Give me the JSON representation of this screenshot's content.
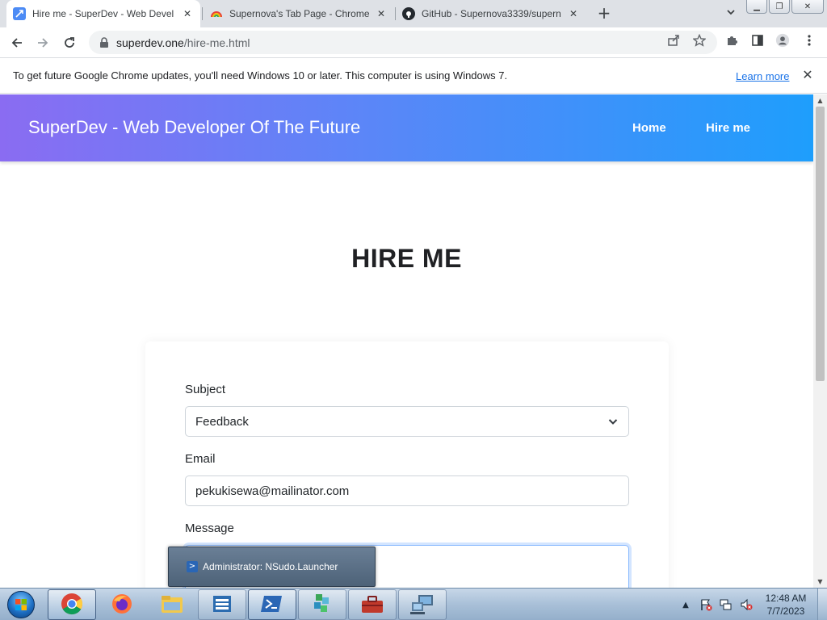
{
  "browser": {
    "tabs": [
      {
        "title": "Hire me - SuperDev - Web Devel",
        "icon": "superdev-favicon",
        "active": true
      },
      {
        "title": "Supernova's Tab Page - Chrome",
        "icon": "rainbow-favicon",
        "active": false
      },
      {
        "title": "GitHub - Supernova3339/supern",
        "icon": "github-favicon",
        "active": false
      }
    ],
    "new_tab_label": "+",
    "url_host": "superdev.one",
    "url_path": "/hire-me.html",
    "infobar": {
      "message": "To get future Google Chrome updates, you'll need Windows 10 or later. This computer is using Windows 7.",
      "learn_more": "Learn more"
    }
  },
  "site": {
    "brand": "SuperDev - Web Developer Of The Future",
    "nav": [
      "Home",
      "Hire me"
    ],
    "heading": "HIRE ME",
    "gradient": [
      "#8a6cf2",
      "#1e9efc"
    ],
    "form": {
      "subject_label": "Subject",
      "subject_value": "Feedback",
      "email_label": "Email",
      "email_value": "pekukisewa@mailinator.com",
      "message_label": "Message",
      "message_value": ""
    }
  },
  "taskbar": {
    "preview_title": "Administrator: NSudo.Launcher",
    "apps": [
      "chrome-icon",
      "firefox-icon",
      "explorer-icon",
      "control-panel-icon",
      "powershell-icon",
      "blocks-icon",
      "toolbox-icon",
      "network-computer-icon"
    ],
    "clock_time": "12:48 AM",
    "clock_date": "7/7/2023"
  }
}
